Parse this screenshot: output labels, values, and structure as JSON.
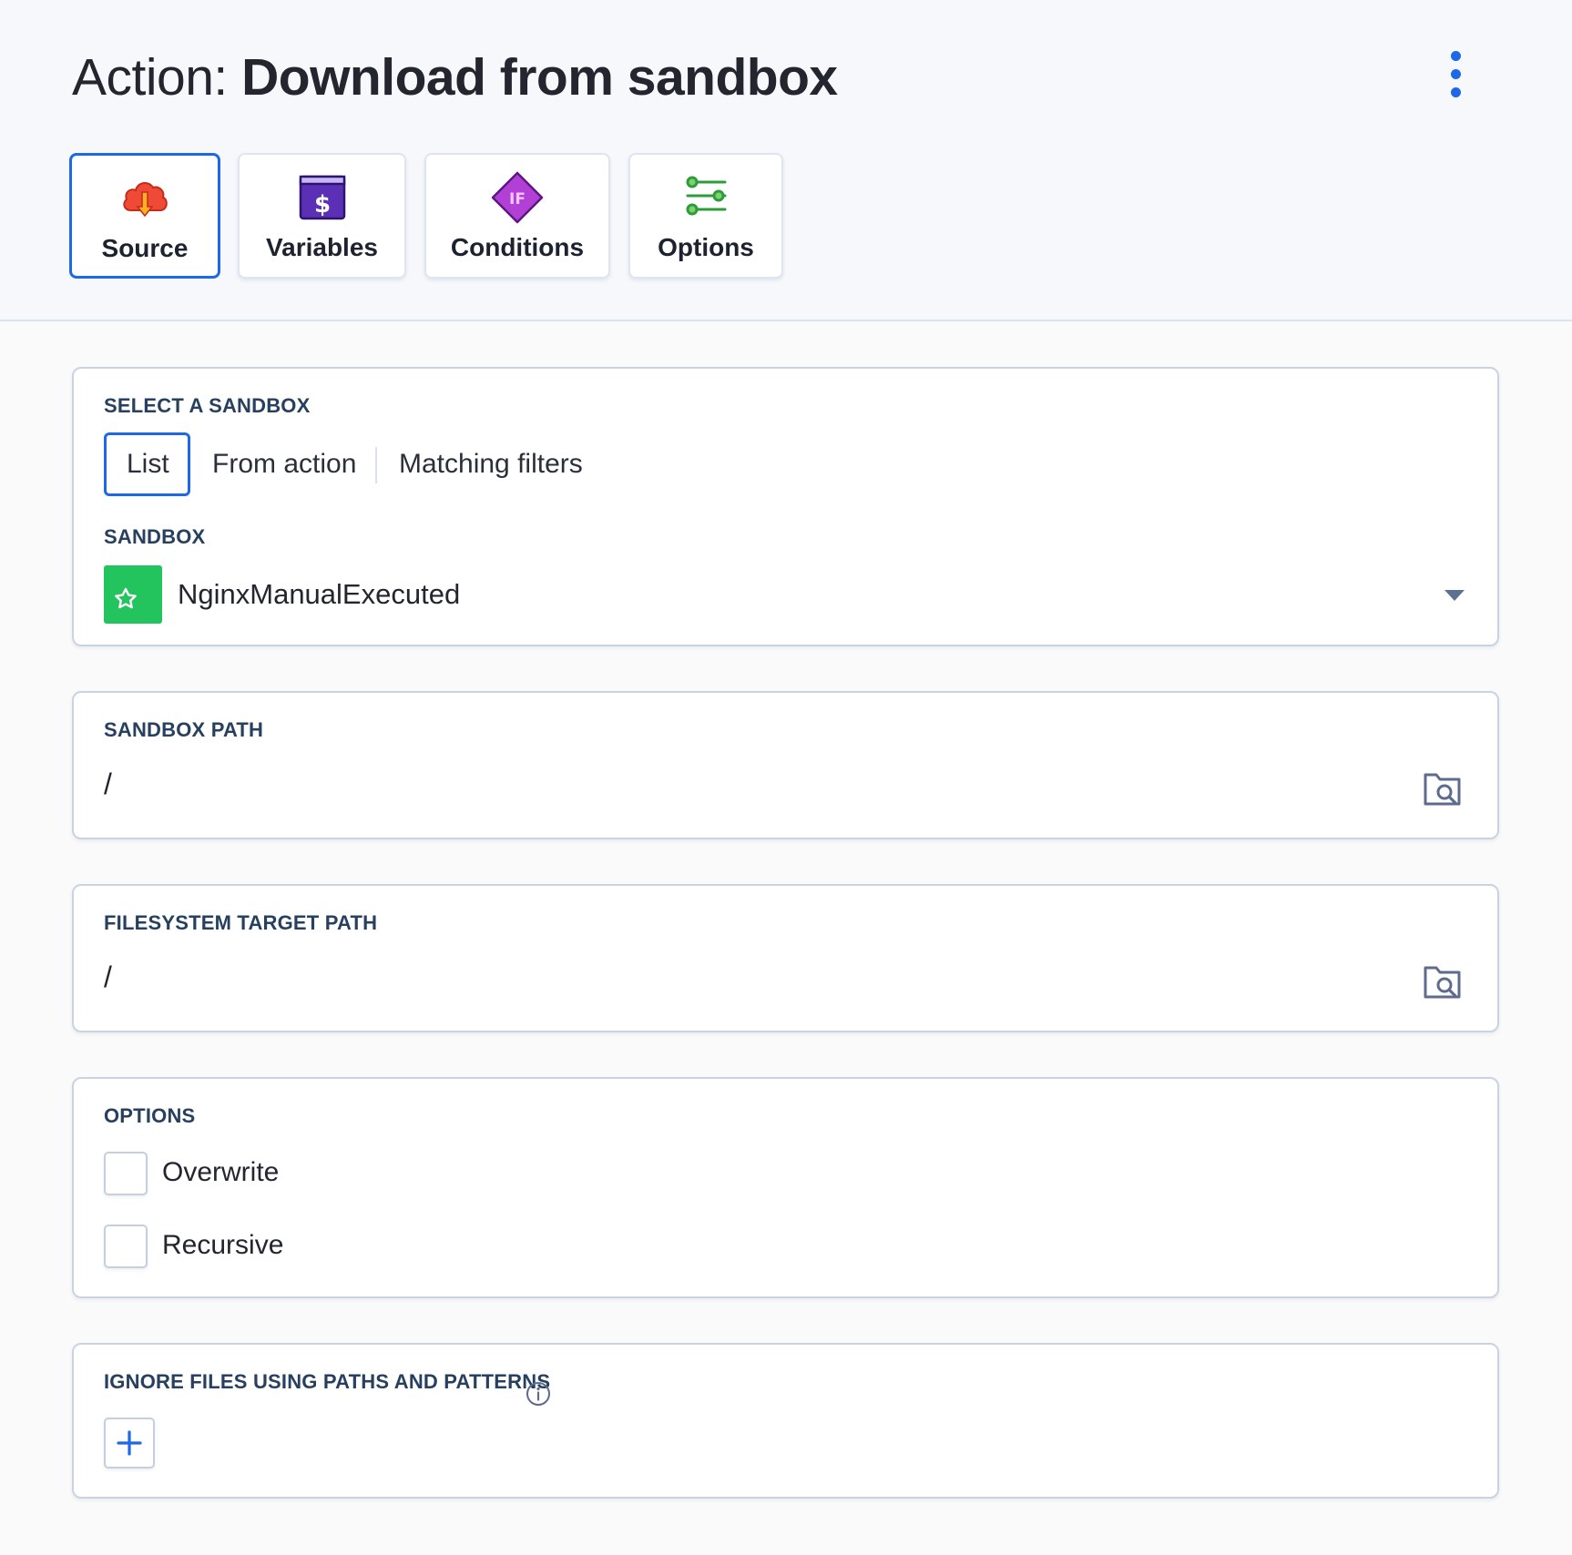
{
  "header": {
    "title_prefix": "Action:",
    "title_name": "Download from sandbox",
    "menu_icon": "kebab-menu-icon"
  },
  "tabs": [
    {
      "label": "Source",
      "icon": "cloud-download-icon",
      "active": true
    },
    {
      "label": "Variables",
      "icon": "dollar-variable-icon",
      "active": false
    },
    {
      "label": "Conditions",
      "icon": "if-diamond-icon",
      "active": false
    },
    {
      "label": "Options",
      "icon": "sliders-icon",
      "active": false
    }
  ],
  "select_sandbox": {
    "label": "SELECT A SANDBOX",
    "modes": [
      "List",
      "From action",
      "Matching filters"
    ],
    "active_mode": "List",
    "sandbox_label": "SANDBOX",
    "sandbox_value": "NginxManualExecuted",
    "sandbox_icon": "star-icon"
  },
  "sandbox_path": {
    "label": "SANDBOX PATH",
    "value": "/",
    "browse_icon": "folder-search-icon"
  },
  "target_path": {
    "label": "FILESYSTEM TARGET PATH",
    "value": "/",
    "browse_icon": "folder-search-icon"
  },
  "options": {
    "label": "OPTIONS",
    "items": [
      {
        "label": "Overwrite",
        "checked": false
      },
      {
        "label": "Recursive",
        "checked": false
      }
    ]
  },
  "ignore": {
    "label": "IGNORE FILES USING PATHS AND PATTERNS",
    "info_icon": "info-icon",
    "add_icon": "plus-icon"
  },
  "colors": {
    "accent": "#1d68e6",
    "section_label": "#27405f",
    "sandbox_badge": "#23c45e",
    "card_border": "#c9d3e3"
  }
}
